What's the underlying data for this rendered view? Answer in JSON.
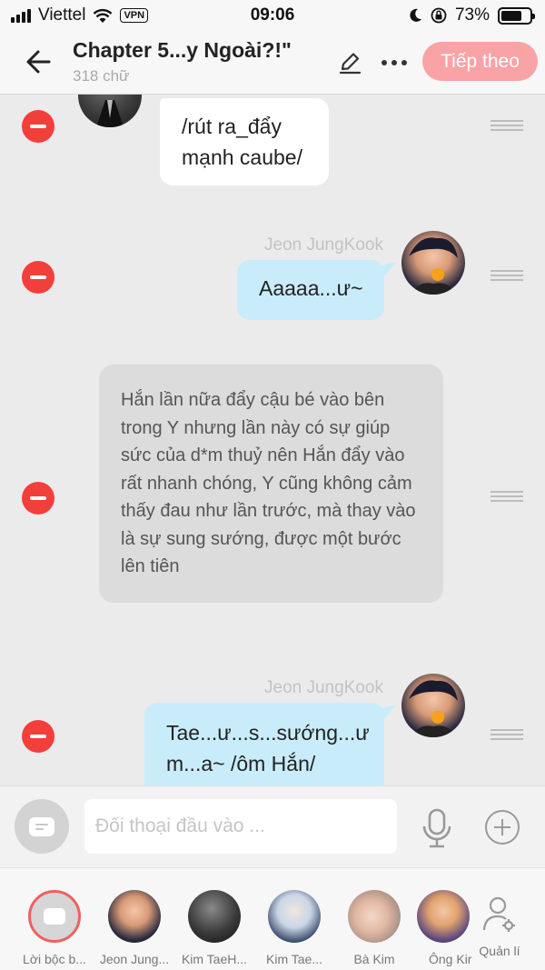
{
  "status_bar": {
    "carrier": "Viettel",
    "vpn": "VPN",
    "time": "09:06",
    "battery": "73%",
    "battery_level": 0.73
  },
  "header": {
    "title": "Chapter 5...y Ngoài?!\"",
    "subtitle": "318 chữ",
    "next_label": "Tiếp theo"
  },
  "messages": [
    {
      "type": "left",
      "text": "/rút ra_đẩy\nmạnh caube/"
    },
    {
      "type": "right",
      "name": "Jeon JungKook",
      "text": "Aaaaa...ư~"
    },
    {
      "type": "narration",
      "text": "Hắn lần nữa đẩy cậu bé vào bên trong Y nhưng lần này có sự giúp sức của d*m thuỷ nên Hắn đẩy vào rất nhanh chóng, Y cũng không cảm thấy đau như lần trước, mà thay vào là sự sung sướng, được một bước lên tiên"
    },
    {
      "type": "right",
      "name": "Jeon JungKook",
      "text": "Tae...ư...s...sướng...ư\nm...a~ /ôm Hắn/"
    }
  ],
  "input": {
    "placeholder": "Đối thoại đầu vào ..."
  },
  "characters": [
    {
      "label": "Lời bộc b..."
    },
    {
      "label": "Jeon Jung..."
    },
    {
      "label": "Kim TaeH..."
    },
    {
      "label": "Kim Tae..."
    },
    {
      "label": "Bà Kim"
    },
    {
      "label": "Ông Kir"
    }
  ],
  "manage_label": "Quản lí",
  "colors": {
    "accent": "#f9a3a6",
    "delete": "#f23f3b",
    "bubble_blue": "#c9ecfa",
    "narration_bg": "#dcdcdc"
  }
}
